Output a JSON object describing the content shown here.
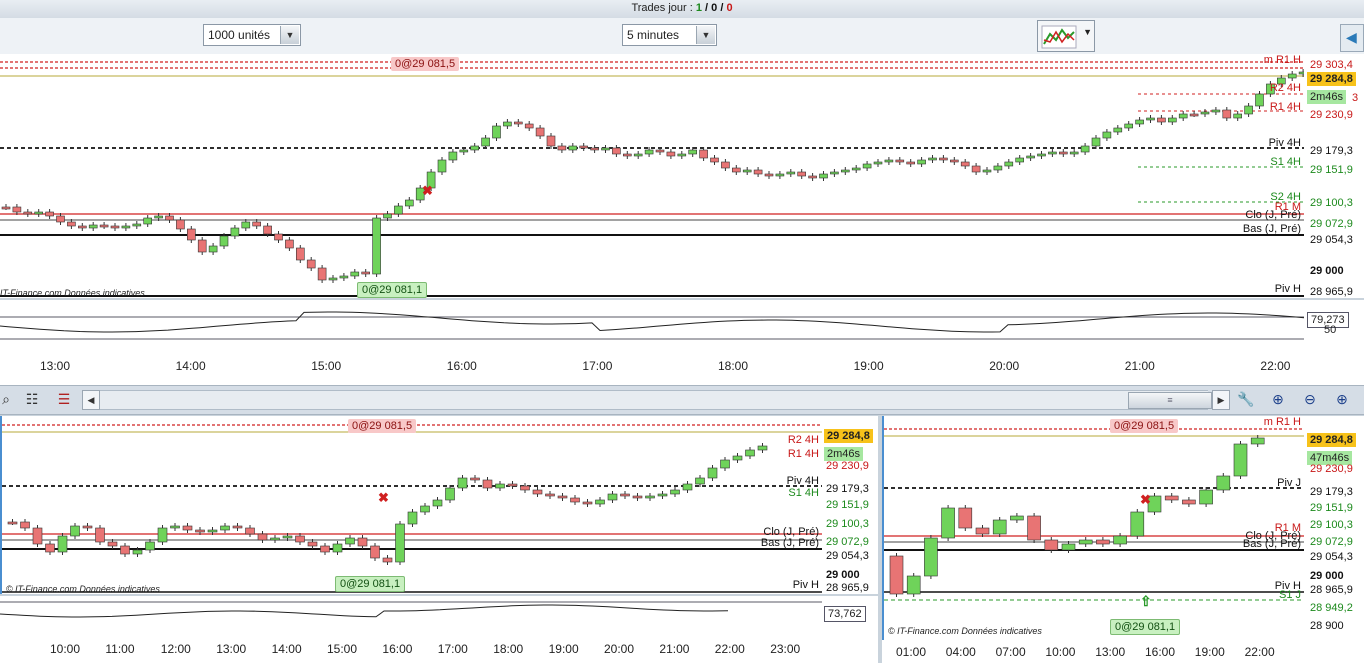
{
  "header": {
    "trades_label": "Trades jour : ",
    "trades_win": "1",
    "trades_sep1": " / ",
    "trades_neutral": "0",
    "trades_sep2": " / ",
    "trades_loss": "0"
  },
  "toolbar": {
    "quantity_value": "1000 unités",
    "timeframe_value": "5 minutes"
  },
  "main_chart": {
    "order_tag_top": "0@29 081,5",
    "order_tag_bottom": "0@29 081,1",
    "copyright": "IT-Finance.com  Données indicatives",
    "price_badge": "29 284,8",
    "countdown": "2m46s",
    "price_labels": [
      "29 303,4",
      "29 230,9",
      "29 179,3",
      "29 151,9",
      "29 100,3",
      "29 072,9",
      "29 054,3",
      "29 000",
      "28 965,9"
    ],
    "level_labels": [
      "m R1 H",
      "R2 4H",
      "R1 4H",
      "Piv 4H",
      "S1 4H",
      "S2 4H",
      "R1 M",
      "Clo (J, Pré)",
      "Bas (J, Pré)",
      "Piv H"
    ],
    "countdown_suffix": "3",
    "osc_value": "79,273",
    "osc_level": "50",
    "time_labels": [
      "13:00",
      "14:00",
      "15:00",
      "16:00",
      "17:00",
      "18:00",
      "19:00",
      "20:00",
      "21:00",
      "22:00"
    ]
  },
  "bottom_left": {
    "order_tag_top": "0@29 081,5",
    "order_tag_bottom": "0@29 081,1",
    "copyright": "© IT-Finance.com  Données indicatives",
    "price_badge": "29 284,8",
    "countdown": "2m46s",
    "price_labels": [
      "29 230,9",
      "29 179,3",
      "29 151,9",
      "29 100,3",
      "29 072,9",
      "29 054,3",
      "29 000",
      "28 965,9"
    ],
    "level_labels": [
      "R2 4H",
      "R1 4H",
      "Piv 4H",
      "S1 4H",
      "Clo (J, Pré)",
      "Bas (J, Pré)",
      "Piv H"
    ],
    "osc_value": "73,762",
    "time_labels": [
      "10:00",
      "11:00",
      "12:00",
      "13:00",
      "14:00",
      "15:00",
      "16:00",
      "17:00",
      "18:00",
      "19:00",
      "20:00",
      "21:00",
      "22:00",
      "23:00"
    ]
  },
  "bottom_right": {
    "order_tag_top": "0@29 081,5",
    "order_tag_bottom": "0@29 081,1",
    "copyright": "© IT-Finance.com  Données indicatives",
    "price_badge": "29 284,8",
    "countdown": "47m46s",
    "price_labels": [
      "29 230,9",
      "29 179,3",
      "29 151,9",
      "29 100,3",
      "29 072,9",
      "29 054,3",
      "29 000",
      "28 965,9",
      "28 949,2",
      "28 900"
    ],
    "level_labels": [
      "m R1 H",
      "Piv J",
      "R1 M",
      "Clo (J, Pré)",
      "Bas (J, Pré)",
      "Piv H",
      "S1 J"
    ],
    "time_labels": [
      "01:00",
      "04:00",
      "07:00",
      "10:00",
      "13:00",
      "16:00",
      "19:00",
      "22:00"
    ]
  },
  "colors": {
    "bull": "#6fd35a",
    "bear": "#e87474",
    "resistance": "#d02020",
    "support": "#2a9a2a",
    "badge": "#f7c21a"
  },
  "icons": [
    "indicator-icon",
    "chevron-down-icon",
    "wrench-icon",
    "zoom-fit-icon",
    "zoom-out-icon",
    "zoom-in-icon",
    "scroll-left-icon",
    "scroll-right-icon"
  ]
}
